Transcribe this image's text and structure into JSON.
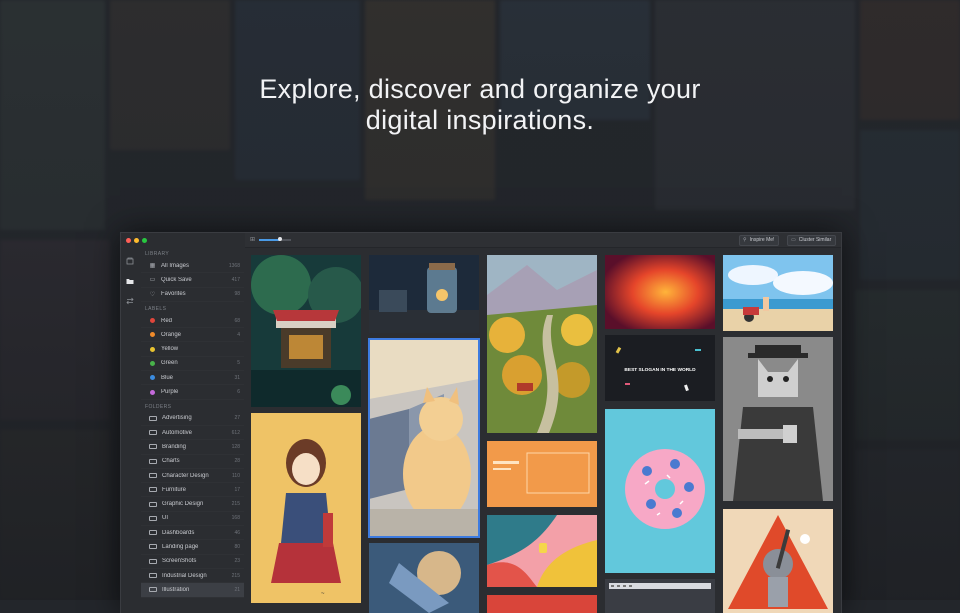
{
  "headline": {
    "line1": "Explore, discover and organize your",
    "line2": "digital inspirations."
  },
  "window": {
    "traffic_colors": [
      "#ff5f57",
      "#febc2e",
      "#28c840"
    ],
    "dock_icons": [
      "library-icon",
      "folder-icon",
      "sort-icon"
    ]
  },
  "toolbar": {
    "slider_value": 0.65,
    "inspire_label": "Inspire Me!",
    "cluster_label": "Cluster Similar"
  },
  "sidebar": {
    "library_title": "LIBRARY",
    "library": [
      {
        "label": "All Images",
        "count": "1368",
        "icon": "images-icon"
      },
      {
        "label": "Quick Save",
        "count": "417",
        "icon": "inbox-icon"
      },
      {
        "label": "Favorites",
        "count": "98",
        "icon": "heart-icon"
      }
    ],
    "labels_title": "LABELS",
    "labels": [
      {
        "label": "Red",
        "count": "68",
        "color": "#e0463c"
      },
      {
        "label": "Orange",
        "count": "4",
        "color": "#ef8a2a"
      },
      {
        "label": "Yellow",
        "count": "",
        "color": "#e8c330"
      },
      {
        "label": "Green",
        "count": "5",
        "color": "#48b24a"
      },
      {
        "label": "Blue",
        "count": "31",
        "color": "#3b8ce0"
      },
      {
        "label": "Purple",
        "count": "6",
        "color": "#c46adb"
      }
    ],
    "folders_title": "FOLDERS",
    "folders": [
      {
        "label": "Advertising",
        "count": "27"
      },
      {
        "label": "Automotive",
        "count": "612"
      },
      {
        "label": "Branding",
        "count": "128"
      },
      {
        "label": "Charts",
        "count": "28"
      },
      {
        "label": "Character Design",
        "count": "110"
      },
      {
        "label": "Furniture",
        "count": "17"
      },
      {
        "label": "Graphic Design",
        "count": "215"
      },
      {
        "label": "UI",
        "count": "168"
      },
      {
        "label": "Dashboards",
        "count": "46"
      },
      {
        "label": "Landing page",
        "count": "80"
      },
      {
        "label": "ScreenShots",
        "count": "23"
      },
      {
        "label": "Industrial Design",
        "count": "215"
      },
      {
        "label": "Illustration",
        "count": "21"
      }
    ]
  },
  "grid": {
    "poster_text": "BEST SLOGAN IN THE WORLD"
  }
}
